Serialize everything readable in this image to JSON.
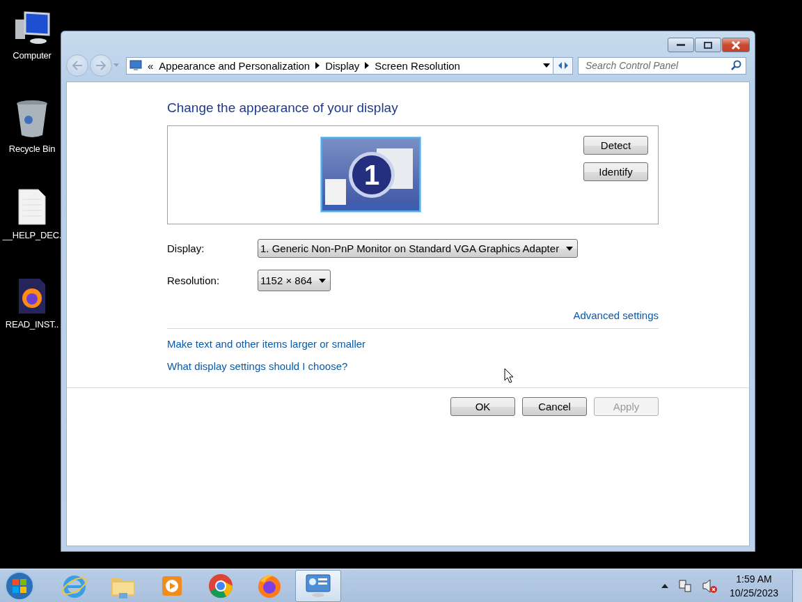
{
  "desktop_icons": [
    {
      "label": "Computer",
      "kind": "computer"
    },
    {
      "label": "Recycle Bin",
      "kind": "recycle"
    },
    {
      "label": "__HELP_DEC.",
      "kind": "document"
    },
    {
      "label": "READ_INST..",
      "kind": "firefox-file"
    }
  ],
  "window": {
    "nav": {
      "back": {
        "disabled": true
      },
      "forward": {
        "disabled": true
      },
      "overflow": "«",
      "breadcrumb": [
        "Appearance and Personalization",
        "Display",
        "Screen Resolution"
      ],
      "search": {
        "placeholder": "Search Control Panel"
      }
    },
    "title": "Change the appearance of your display",
    "monitor": {
      "number": "1",
      "selected": true
    },
    "preview_buttons": [
      {
        "label": "Detect"
      },
      {
        "label": "Identify"
      }
    ],
    "fields": [
      {
        "label": "Display:",
        "value": "1. Generic Non-PnP Monitor on Standard VGA Graphics Adapter"
      },
      {
        "label": "Resolution:",
        "value": "1152 × 864"
      }
    ],
    "advanced_link": "Advanced settings",
    "links": [
      "Make text and other items larger or smaller",
      "What display settings should I choose?"
    ],
    "actions": [
      {
        "label": "OK",
        "disabled": false
      },
      {
        "label": "Cancel",
        "disabled": false
      },
      {
        "label": "Apply",
        "disabled": true
      }
    ]
  },
  "taskbar": {
    "apps": [
      {
        "kind": "ie",
        "selected": false
      },
      {
        "kind": "explorer",
        "selected": false
      },
      {
        "kind": "media",
        "selected": false
      },
      {
        "kind": "chrome",
        "selected": false
      },
      {
        "kind": "firefox",
        "selected": false
      },
      {
        "kind": "control-panel",
        "selected": true
      }
    ],
    "time": "1:59 AM",
    "date": "10/25/2023"
  }
}
